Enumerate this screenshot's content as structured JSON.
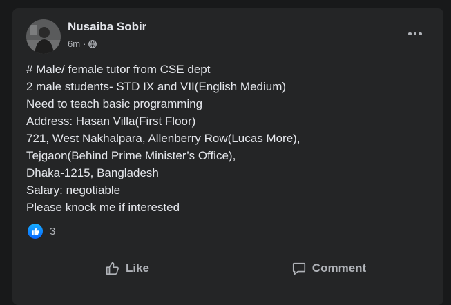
{
  "post": {
    "author": "Nusaiba Sobir",
    "timestamp": "6m",
    "separator": "·",
    "audience_icon": "public-globe-icon",
    "lines": [
      "# Male/ female tutor from CSE dept",
      "2 male students- STD IX and VII(English Medium)",
      "Need to teach basic programming",
      "Address: Hasan Villa(First Floor)",
      "721, West Nakhalpara, Allenberry Row(Lucas More),",
      "Tejgaon(Behind Prime Minister’s Office),",
      "Dhaka-1215, Bangladesh",
      "Salary: negotiable",
      "Please knock me if interested"
    ]
  },
  "reactions": {
    "count": "3",
    "icon": "like-reaction-icon"
  },
  "actions": {
    "like_label": "Like",
    "comment_label": "Comment"
  },
  "colors": {
    "background": "#18191a",
    "card": "#242526",
    "primary_text": "#e4e6eb",
    "secondary_text": "#b0b3b8",
    "like_blue": "#0866ff",
    "divider": "#3e4042"
  }
}
